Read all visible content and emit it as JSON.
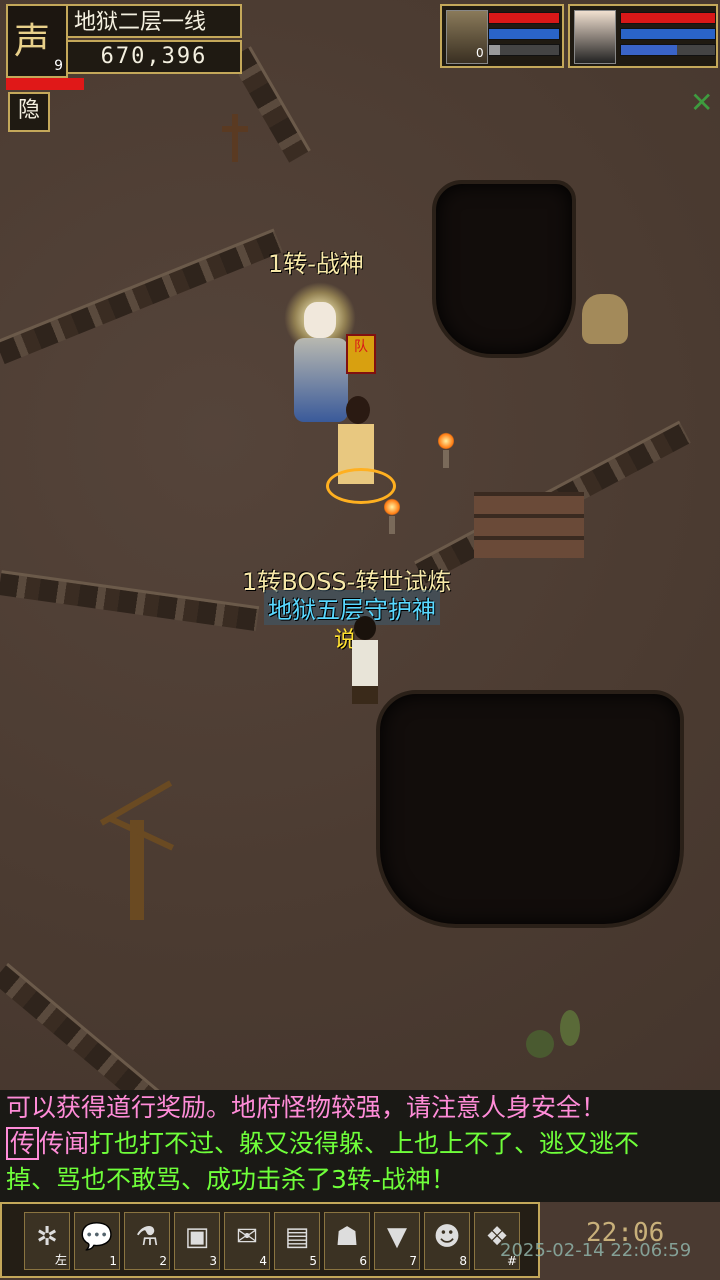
{
  "hud": {
    "avatar_char": "声",
    "level": "9",
    "map_name": "地狱二层一线",
    "coordinates": "670,396",
    "hide_label": "隐",
    "player_hp_fraction": 0.7
  },
  "party": {
    "pet_level": "0",
    "pet_hp_fraction": 1.0,
    "pet_mp_fraction": 1.0,
    "pet_xp_fraction": 0.15,
    "player_hp_fraction": 1.0,
    "player_mp_fraction": 1.0,
    "player_xp_fraction": 0.6
  },
  "npcs": {
    "warrior_god_label": "1转-战神",
    "boss_label": "1转BOSS-转世试炼",
    "guardian_label": "地狱五层守护神",
    "emote": "说"
  },
  "chat": {
    "line1": "可以获得道行奖励。地府怪物较强，请注意人身安全！",
    "rumor_tag": "传",
    "rumor_word": "传闻",
    "line2_green": "打也打不过、躲又没得躲、上也上不了、逃又逃不",
    "line3_green": "掉、骂也不敢骂、成功击杀了3转-战神！"
  },
  "toolbar": {
    "slots": [
      {
        "icon": "settings-icon",
        "glyph": "✲",
        "key": "左"
      },
      {
        "icon": "chat-icon",
        "glyph": "💬",
        "key": "1"
      },
      {
        "icon": "potion-icon",
        "glyph": "⚗",
        "key": "2"
      },
      {
        "icon": "bag-icon",
        "glyph": "▣",
        "key": "3"
      },
      {
        "icon": "scroll-icon",
        "glyph": "✉",
        "key": "4"
      },
      {
        "icon": "card-icon",
        "glyph": "▤",
        "key": "5"
      },
      {
        "icon": "pet-icon",
        "glyph": "☗",
        "key": "6"
      },
      {
        "icon": "flag-icon",
        "glyph": "▼",
        "key": "7"
      },
      {
        "icon": "team-icon",
        "glyph": "☻",
        "key": "8"
      },
      {
        "icon": "mount-icon",
        "glyph": "❖",
        "key": "#"
      }
    ]
  },
  "clock": "22:06",
  "datestamp": "2025-02-14 22:06:59",
  "colors": {
    "frame_gold": "#c4a85a",
    "chat_pink": "#ff8cd8",
    "chat_green": "#6fff3a",
    "label_yellow": "#f7e8a8",
    "label_cyan": "#59d8ff"
  }
}
